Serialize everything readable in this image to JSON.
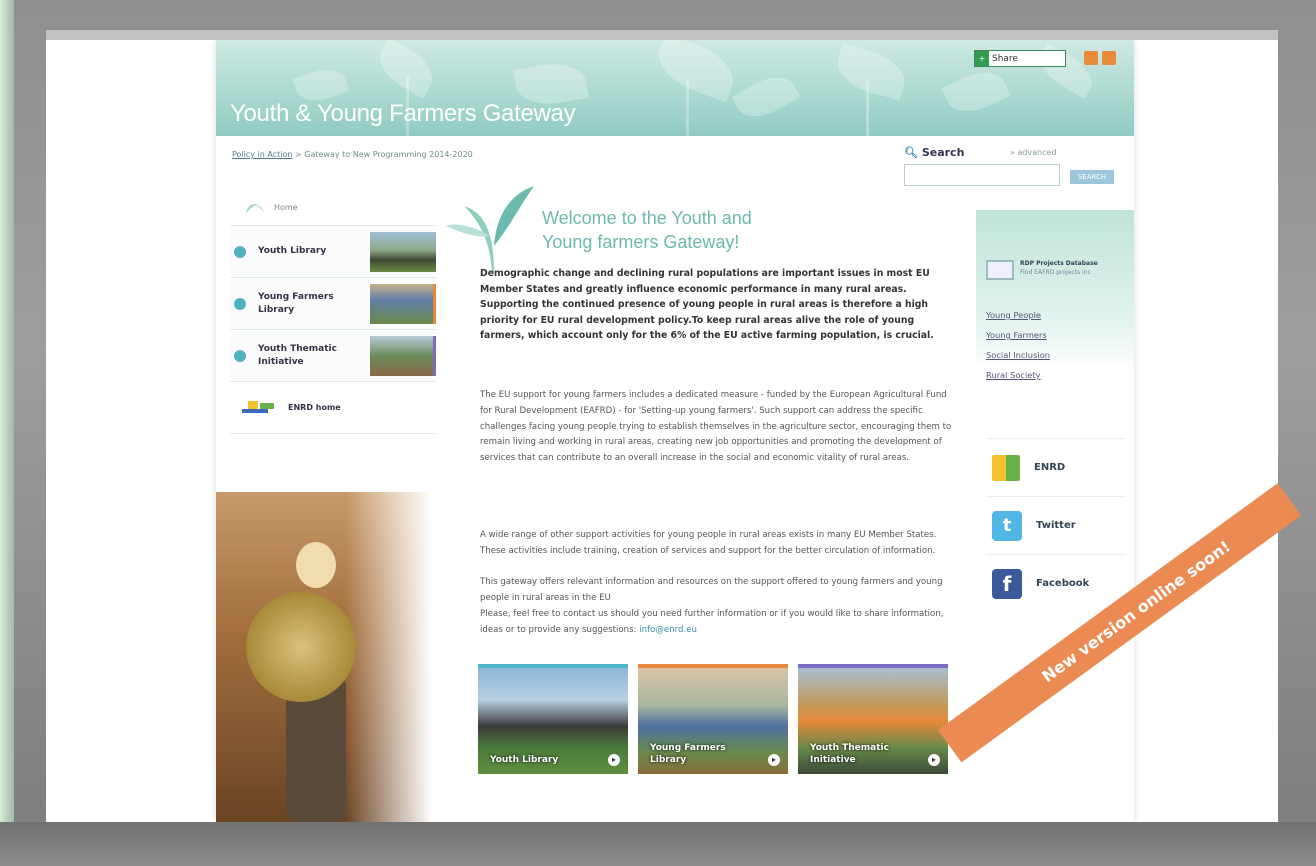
{
  "header": {
    "site_title": "Youth & Young Farmers Gateway",
    "share_label": "Share"
  },
  "breadcrumb": {
    "link": "Policy in Action",
    "sep": " > ",
    "current": "Gateway to New Programming 2014-2020"
  },
  "search": {
    "label": "Search",
    "advanced": "» advanced",
    "button": "SEARCH",
    "value": ""
  },
  "nav": {
    "home": "Home",
    "items": [
      {
        "label": "Youth Library"
      },
      {
        "label": "Young Farmers Library"
      },
      {
        "label": "Youth Thematic Initiative"
      }
    ],
    "enrd_home": "ENRD home"
  },
  "main": {
    "welcome_line1": "Welcome to the Youth and",
    "welcome_line2": "Young farmers Gateway!",
    "lead": "Demographic change and declining rural populations are important issues in most EU Member States and greatly influence economic performance in many rural areas. Supporting the continued presence of young people in rural areas is therefore a high priority for EU rural development policy.To keep rural areas alive the role of young farmers, which account only for the 6% of the EU active farming population, is crucial.",
    "para1": "The EU support for young farmers includes a dedicated measure - funded by the European Agricultural Fund for Rural Development (EAFRD) - for 'Setting-up young farmers'. Such support can address the specific challenges facing young people trying to establish themselves in the agriculture sector, encouraging them to remain living and working in rural areas, creating new job opportunities and promoting the development of services that can contribute to an overall increase in the social and economic vitality of rural areas.",
    "para2": "A wide range of other support activities for young people in rural areas exists in many EU Member States. These activities include training, creation of services and support for the better circulation of information.",
    "para3": "This gateway offers relevant information and resources on the support offered to young farmers and young people in rural areas in the EU",
    "para4": "Please, feel free to contact us should you need further information or if you would like to share information, ideas or to provide any suggestions:",
    "email": "info@enrd.eu"
  },
  "tiles": [
    {
      "label": "Youth Library",
      "bar_color": "#4bb7c7"
    },
    {
      "label": "Young Farmers Library",
      "bar_color": "#e9883a"
    },
    {
      "label": "Youth Thematic Initiative",
      "bar_color": "#7b6bc4"
    }
  ],
  "sidebar": {
    "rdp_title": "RDP Projects Database",
    "rdp_sub": "Find EAFRD projects inc",
    "links": [
      "Young People",
      "Young Farmers",
      "Social Inclusion",
      "Rural Society"
    ],
    "social": [
      {
        "label": "ENRD",
        "icon": "enrd-logo-icon"
      },
      {
        "label": "Twitter",
        "icon": "twitter-icon"
      },
      {
        "label": "Facebook",
        "icon": "facebook-icon"
      }
    ]
  },
  "ribbon": "New version online soon!",
  "colors": {
    "header": "#a9d8cf",
    "accent_teal": "#6cb9ad",
    "ribbon": "#ec8a53"
  }
}
